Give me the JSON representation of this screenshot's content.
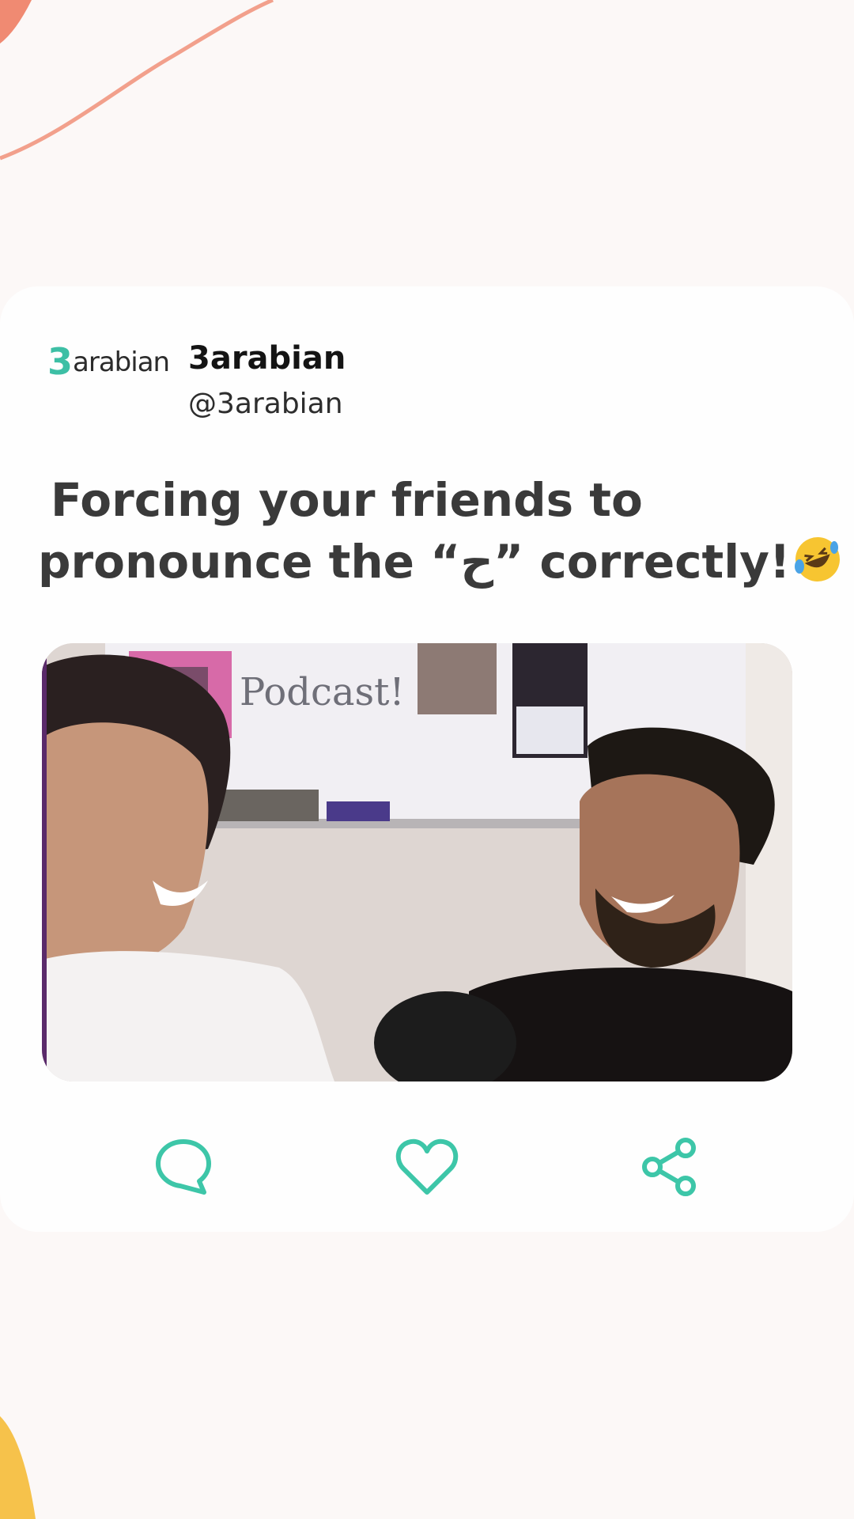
{
  "post": {
    "logo_prefix": "3",
    "logo_text": "arabian",
    "account_name": "3arabian",
    "account_handle": "@3arabian",
    "caption_line1": "Forcing your friends to",
    "caption_line2": "pronounce the “ح” correctly!",
    "caption_emoji": "rolling-on-floor-laughing-emoji",
    "video_whiteboard_text": "Podcast!"
  },
  "actions": [
    {
      "name": "comment",
      "icon": "speech-bubble-icon"
    },
    {
      "name": "like",
      "icon": "heart-icon"
    },
    {
      "name": "share",
      "icon": "share-nodes-icon"
    }
  ],
  "colors": {
    "accent": "#3dc6a8",
    "background": "#fcf8f7",
    "card": "#fefefe",
    "deco_coral": "#ef8d78",
    "deco_yellow": "#f6c24b"
  }
}
